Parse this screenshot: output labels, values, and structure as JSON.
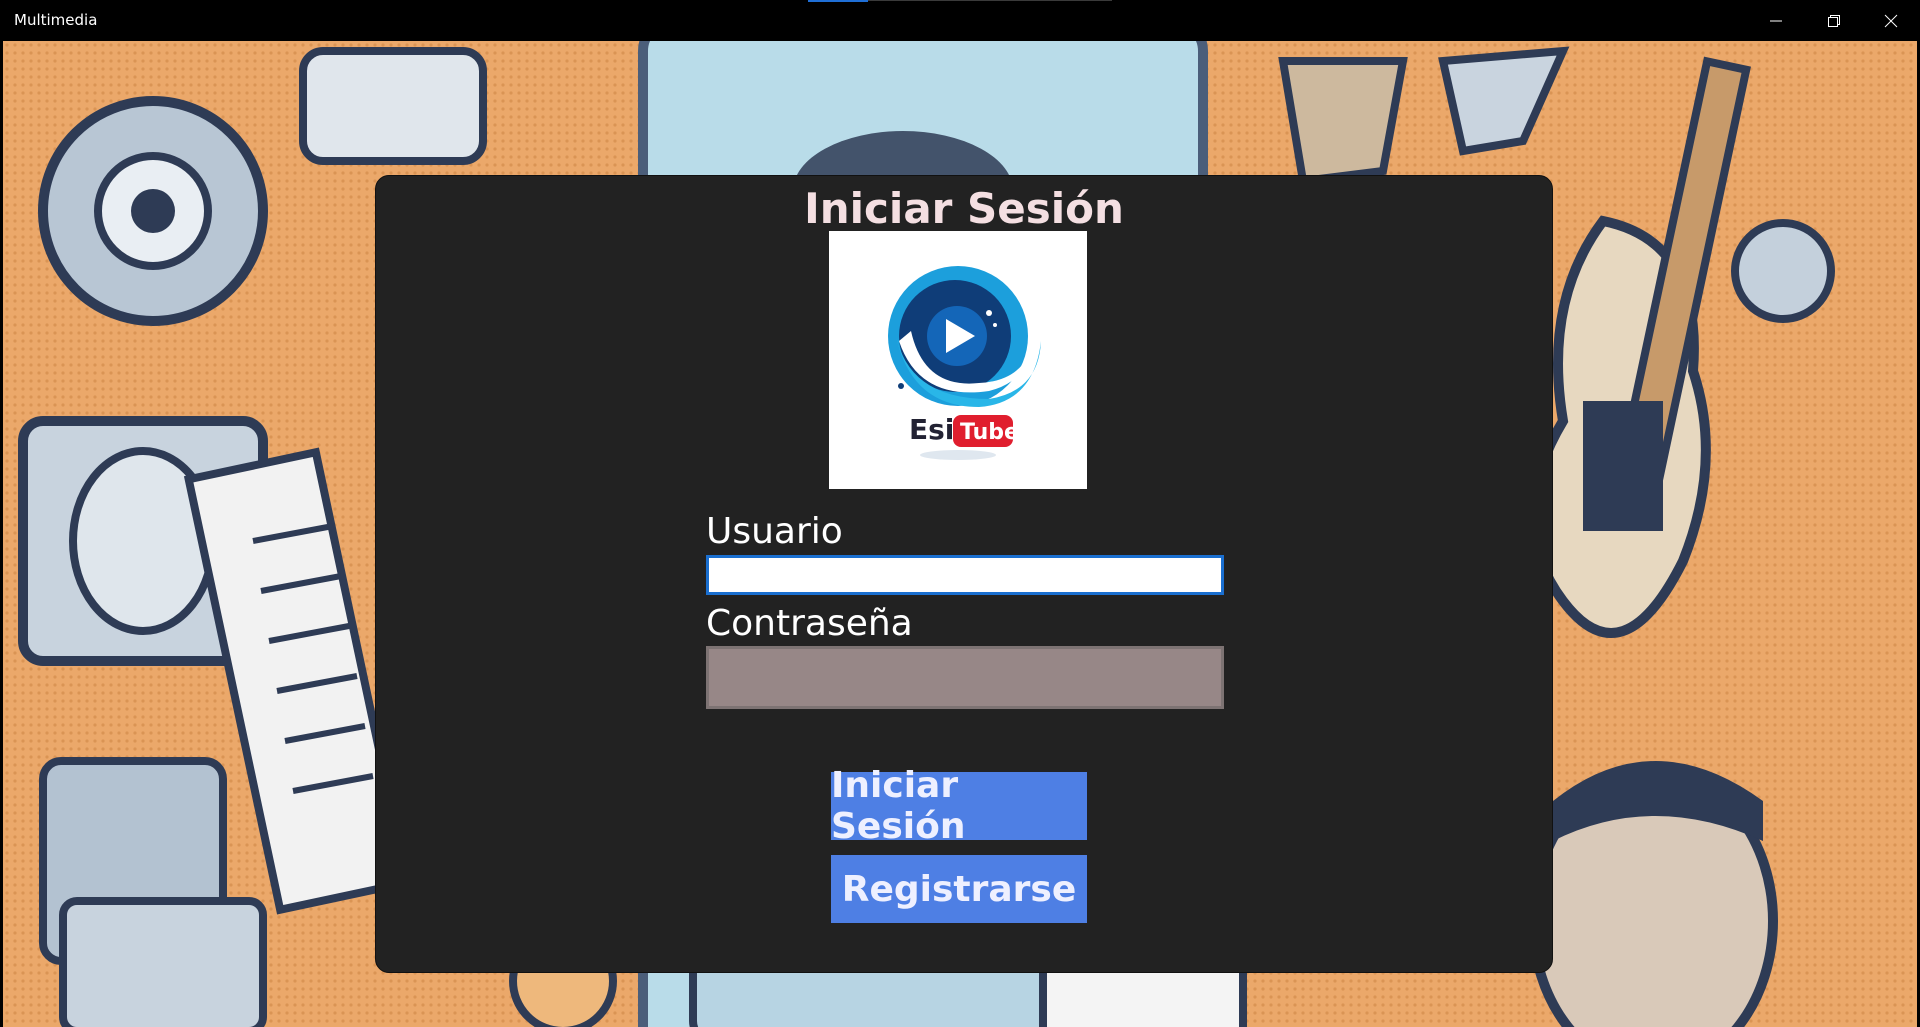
{
  "window": {
    "title": "Multimedia",
    "controls": {
      "minimize_icon": "minimize-icon",
      "maximize_icon": "restore-icon",
      "close_icon": "close-icon"
    }
  },
  "login": {
    "heading": "Iniciar Sesión",
    "logo": {
      "brand_left": "Esi",
      "brand_right": "Tube"
    },
    "username_label": "Usuario",
    "username_value": "",
    "password_label": "Contraseña",
    "password_value": "",
    "login_button": "Iniciar Sesión",
    "register_button": "Registrarse"
  },
  "colors": {
    "panel": "#222222",
    "button": "#4e7fe4",
    "input_focus_border": "#1a6fd0",
    "password_field": "#978787",
    "logo_red": "#e01e2e"
  }
}
